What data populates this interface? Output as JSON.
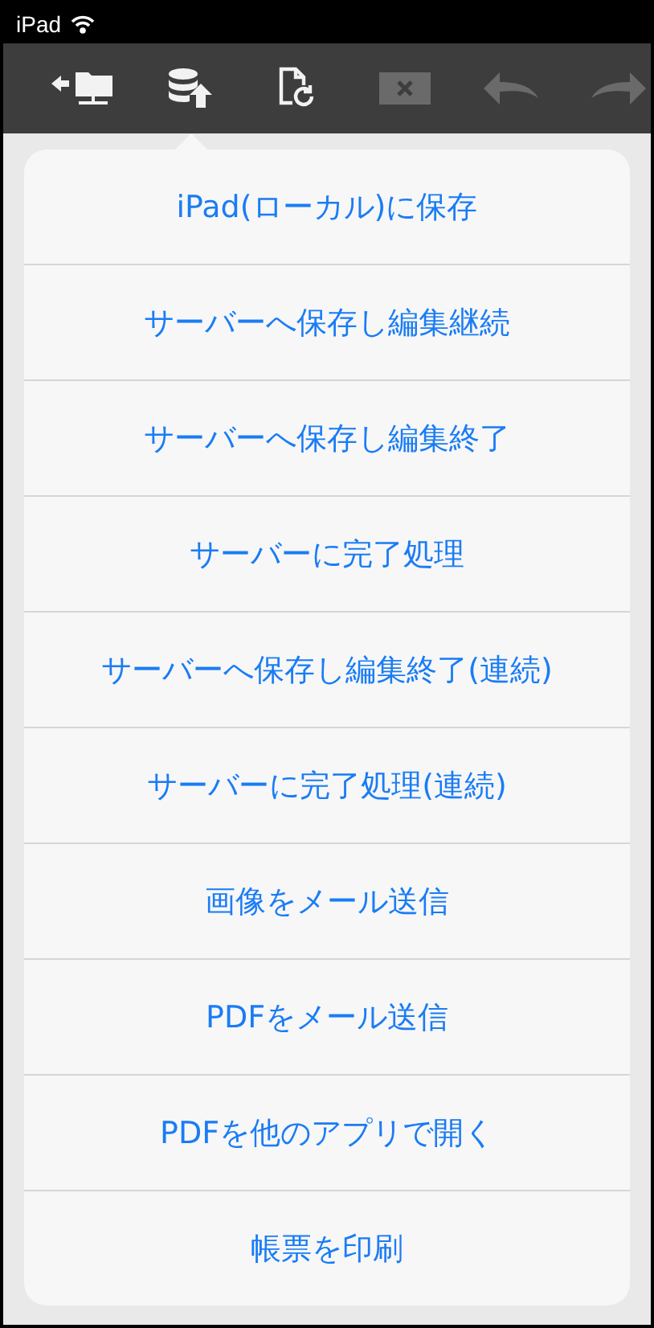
{
  "status_bar": {
    "device": "iPad"
  },
  "toolbar": [
    {
      "kind": "network-back",
      "disabled": false,
      "selected": false
    },
    {
      "kind": "upload-db",
      "disabled": false,
      "selected": true
    },
    {
      "kind": "doc-refresh",
      "disabled": false,
      "selected": false
    },
    {
      "kind": "delete",
      "disabled": true,
      "selected": false
    },
    {
      "kind": "undo",
      "disabled": true,
      "selected": false
    },
    {
      "kind": "redo",
      "disabled": true,
      "selected": false
    }
  ],
  "menu": [
    "iPad(ローカル)に保存",
    "サーバーへ保存し編集継続",
    "サーバーへ保存し編集終了",
    "サーバーに完了処理",
    "サーバーへ保存し編集終了(連続)",
    "サーバーに完了処理(連続)",
    "画像をメール送信",
    "PDFをメール送信",
    "PDFを他のアプリで開く",
    "帳票を印刷"
  ]
}
